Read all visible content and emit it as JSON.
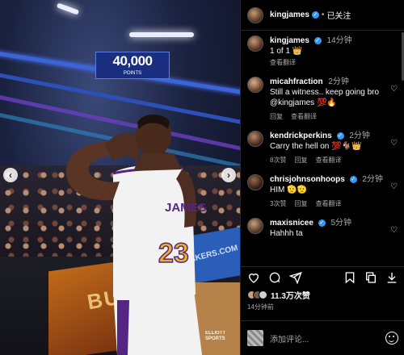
{
  "header": {
    "username": "kingjames",
    "follow_state": "已关注"
  },
  "scene": {
    "scoreboard_big": "40,000",
    "scoreboard_small": "POINTS",
    "court_text": "BU",
    "board_text": "LAKERS.COM",
    "jersey_name": "JAMES",
    "jersey_number": "23",
    "watermark": "ELLIOTT SPORTS"
  },
  "caption": {
    "username": "kingjames",
    "time": "14分钟",
    "text": "1 of 1 👑",
    "translate": "查看翻译"
  },
  "comments": [
    {
      "username": "micahfraction",
      "verified": false,
      "time": "2分钟",
      "text": "Still a witness.. keep going bro @kingjames 💯🔥",
      "likes": "",
      "reply": "回复",
      "translate": "查看翻译"
    },
    {
      "username": "kendrickperkins",
      "verified": true,
      "time": "2分钟",
      "text": "Carry the hell on 💯🐐👑",
      "likes": "8次赞",
      "reply": "回复",
      "translate": "查看翻译"
    },
    {
      "username": "chrisjohnsonhoops",
      "verified": true,
      "time": "2分钟",
      "text": "HIM 🫡🫡",
      "likes": "3次赞",
      "reply": "回复",
      "translate": "查看翻译"
    },
    {
      "username": "maxisnicee",
      "verified": true,
      "time": "5分钟",
      "text": "Hahhh ta",
      "likes": "",
      "reply": "",
      "translate": ""
    }
  ],
  "likes": {
    "count_text": "11.3万次赞"
  },
  "post_time": "14分钟前",
  "add_comment": {
    "placeholder": "添加评论..."
  },
  "colors": {
    "verified": "#3897f0",
    "background": "#000000",
    "jersey": "#f2f2f2",
    "jersey_number": "#f0b21a",
    "lakers_purple": "#552583"
  },
  "icons": [
    "heart-icon",
    "comment-icon",
    "share-icon",
    "bookmark-icon",
    "copy-icon",
    "download-icon",
    "emoji-icon",
    "chevron-left-icon",
    "chevron-right-icon",
    "verified-icon"
  ]
}
